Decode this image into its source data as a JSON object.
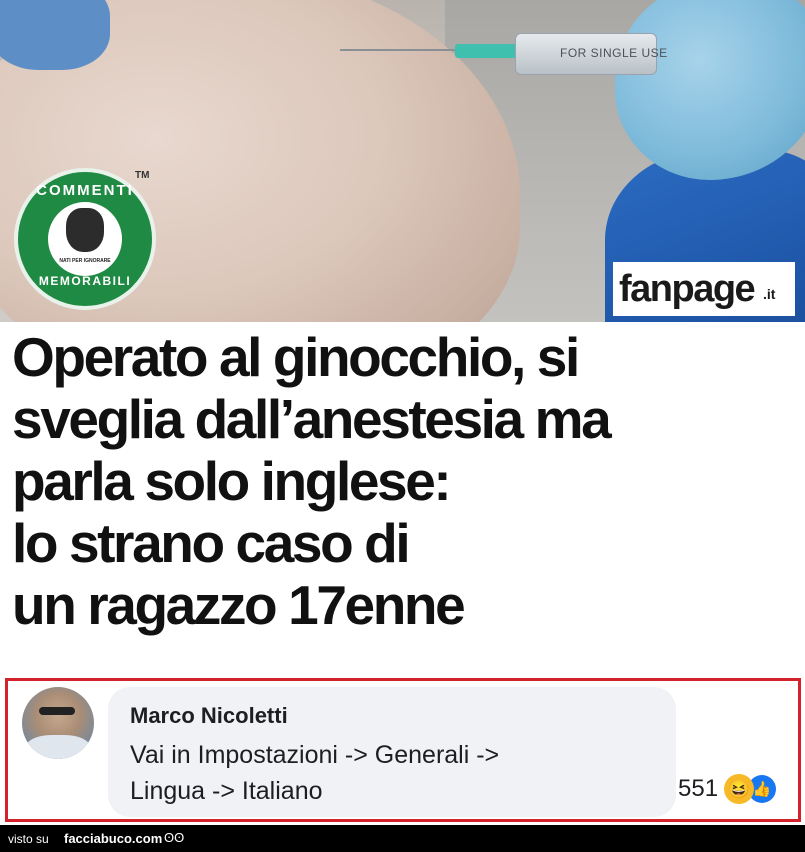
{
  "image": {
    "syringe_text": "FOR SINGLE USE",
    "badge": {
      "top_text": "COMMENTI",
      "bottom_text": "MEMORABILI",
      "center_text": "NATI PER IGNORARE",
      "tm": "TM"
    },
    "source_logo": {
      "main": "fanpage",
      "suffix": ".it"
    }
  },
  "headline": {
    "lines": [
      "Operato al ginocchio, si",
      "sveglia dall’anestesia ma",
      "parla solo inglese:",
      "lo strano caso di",
      "un ragazzo 17enne"
    ]
  },
  "comment": {
    "author": "Marco Nicoletti",
    "text_lines": [
      "Vai in Impostazioni -> Generali ->",
      "Lingua -> Italiano"
    ],
    "reaction_count": "551",
    "reaction_icons": [
      "haha-icon",
      "like-icon"
    ],
    "highlight_color": "#d3222b"
  },
  "footer": {
    "prefix": "visto su",
    "site": "facciabuco.com",
    "eyes_icon": "ʘʘ"
  }
}
